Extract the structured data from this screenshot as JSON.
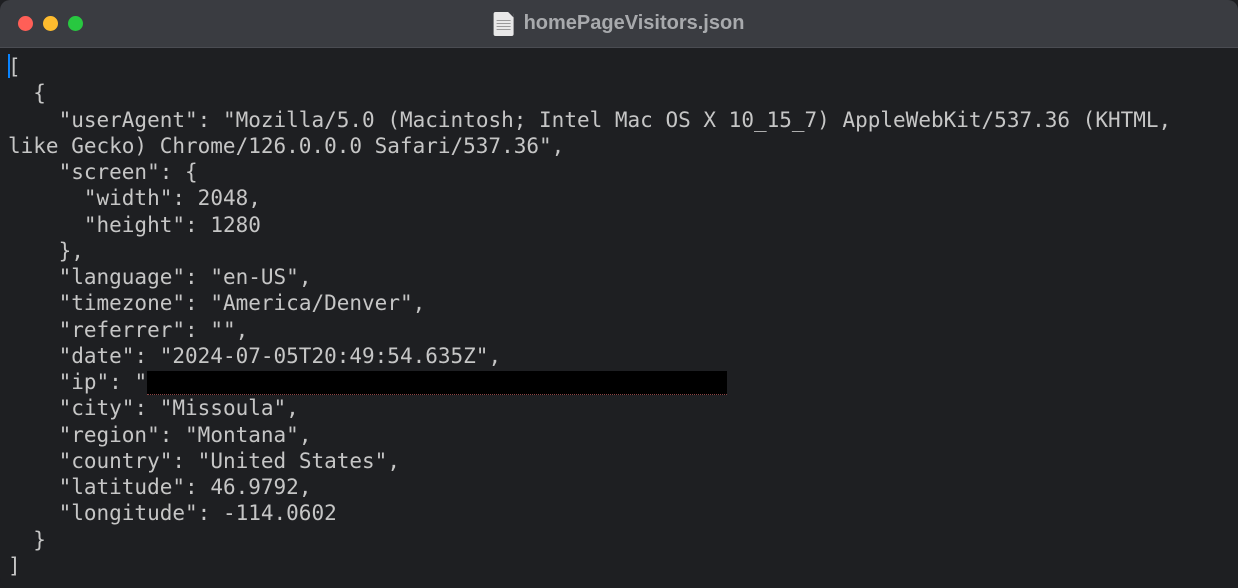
{
  "window": {
    "title": "homePageVisitors.json"
  },
  "json_content": {
    "keys": {
      "userAgent": "\"userAgent\"",
      "screen": "\"screen\"",
      "width": "\"width\"",
      "height": "\"height\"",
      "language": "\"language\"",
      "timezone": "\"timezone\"",
      "referrer": "\"referrer\"",
      "date": "\"date\"",
      "ip": "\"ip\"",
      "city": "\"city\"",
      "region": "\"region\"",
      "country": "\"country\"",
      "latitude": "\"latitude\"",
      "longitude": "\"longitude\""
    },
    "values": {
      "userAgent": "\"Mozilla/5.0 (Macintosh; Intel Mac OS X 10_15_7) AppleWebKit/537.36 (KHTML, like Gecko) Chrome/126.0.0.0 Safari/537.36\"",
      "width": "2048",
      "height": "1280",
      "language": "\"en-US\"",
      "timezone": "\"America/Denver\"",
      "referrer": "\"\"",
      "date": "\"2024-07-05T20:49:54.635Z\"",
      "ip_prefix": "\"",
      "city": "\"Missoula\"",
      "region": "\"Montana\"",
      "country": "\"United States\"",
      "latitude": "46.9792",
      "longitude": "-114.0602"
    },
    "punct": {
      "open_bracket": "[",
      "close_bracket": "]",
      "open_brace": "{",
      "close_brace": "}",
      "close_brace_comma": "},",
      "colon_space": ": ",
      "comma": ","
    }
  }
}
